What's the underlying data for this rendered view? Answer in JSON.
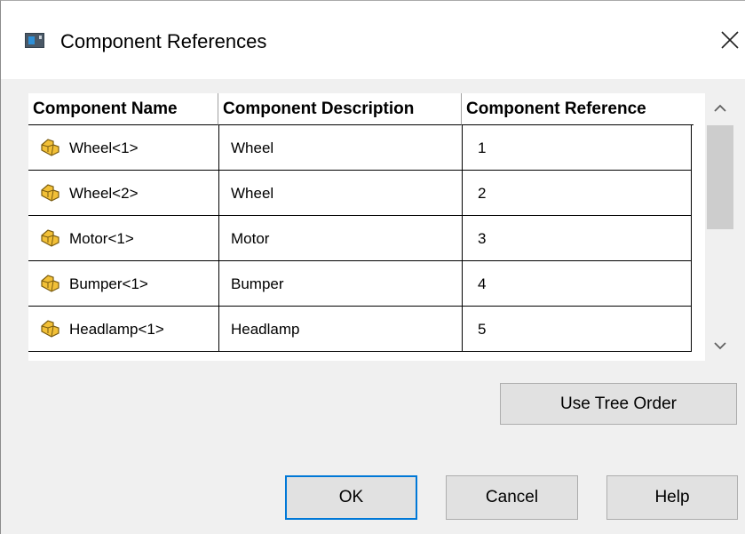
{
  "window": {
    "title": "Component References"
  },
  "table": {
    "headers": [
      "Component Name",
      "Component Description",
      "Component Reference"
    ],
    "rows": [
      {
        "name": "Wheel<1>",
        "description": "Wheel",
        "reference": "1"
      },
      {
        "name": "Wheel<2>",
        "description": "Wheel",
        "reference": "2"
      },
      {
        "name": "Motor<1>",
        "description": "Motor",
        "reference": "3"
      },
      {
        "name": "Bumper<1>",
        "description": "Bumper",
        "reference": "4"
      },
      {
        "name": "Headlamp<1>",
        "description": "Headlamp",
        "reference": "5"
      }
    ]
  },
  "buttons": {
    "use_tree_order": "Use Tree Order",
    "ok": "OK",
    "cancel": "Cancel",
    "help": "Help"
  },
  "icons": {
    "window": "app-window-icon",
    "row": "part-component-icon",
    "close": "close-icon",
    "scroll_up": "chevron-up-icon",
    "scroll_down": "chevron-down-icon"
  },
  "colors": {
    "dialog_bg": "#f0f0f0",
    "default_button_border": "#0078d7",
    "part_icon": "#f2c037"
  }
}
